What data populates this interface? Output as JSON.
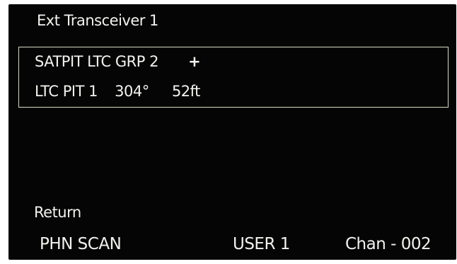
{
  "header": {
    "title": "Ext Transceiver 1"
  },
  "group": {
    "name": "SATPIT LTC GRP 2",
    "expand_symbol": "+",
    "entry": {
      "name": "LTC PIT 1",
      "bearing": "304°",
      "distance": "52ft"
    }
  },
  "menu": {
    "return_label": "Return"
  },
  "status_bar": {
    "mode": "PHN SCAN",
    "user": "USER 1",
    "channel": "Chan -  002"
  }
}
